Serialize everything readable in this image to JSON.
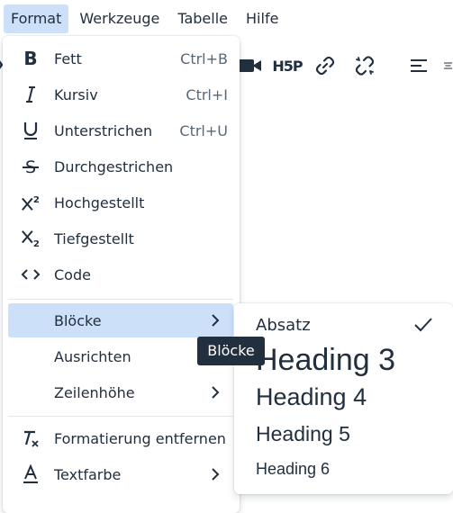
{
  "menubar": {
    "items": [
      {
        "label": "Format"
      },
      {
        "label": "Werkzeuge"
      },
      {
        "label": "Tabelle"
      },
      {
        "label": "Hilfe"
      }
    ]
  },
  "toolbar": {
    "h5p_label": "H5P"
  },
  "format_menu": {
    "items": [
      {
        "label": "Fett",
        "shortcut": "Ctrl+B",
        "icon": "bold-icon"
      },
      {
        "label": "Kursiv",
        "shortcut": "Ctrl+I",
        "icon": "italic-icon"
      },
      {
        "label": "Unterstrichen",
        "shortcut": "Ctrl+U",
        "icon": "underline-icon"
      },
      {
        "label": "Durchgestrichen",
        "icon": "strikethrough-icon"
      },
      {
        "label": "Hochgestellt",
        "icon": "superscript-icon"
      },
      {
        "label": "Tiefgestellt",
        "icon": "subscript-icon"
      },
      {
        "label": "Code",
        "icon": "code-icon"
      },
      {
        "label": "Blöcke",
        "submenu": true
      },
      {
        "label": "Ausrichten"
      },
      {
        "label": "Zeilenhöhe",
        "submenu": true
      },
      {
        "label": "Formatierung entfernen",
        "icon": "remove-formatting-icon"
      },
      {
        "label": "Textfarbe",
        "submenu": true,
        "icon": "text-color-icon"
      }
    ]
  },
  "blocks_submenu": {
    "items": [
      {
        "label": "Absatz",
        "selected": true
      },
      {
        "label": "Heading 3"
      },
      {
        "label": "Heading 4"
      },
      {
        "label": "Heading 5"
      },
      {
        "label": "Heading 6"
      }
    ]
  },
  "tooltip": {
    "text": "Blöcke"
  },
  "colors": {
    "active_highlight": "#cce0fa",
    "text": "#222f3e",
    "tooltip_bg": "#222f3e"
  }
}
